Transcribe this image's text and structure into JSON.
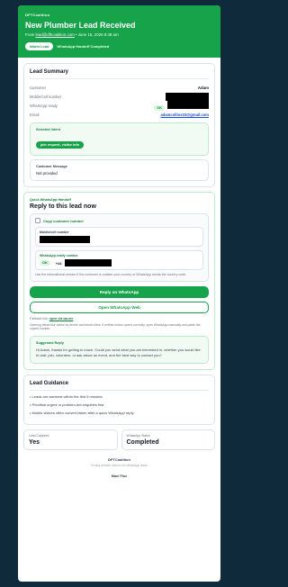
{
  "header": {
    "brand": "DFTCoalition",
    "title": "New Plumber Lead Received",
    "from_prefix": "From",
    "from_address": "lead@dftcoalition.com",
    "date_text": " • June 15, 2026 8:48 am",
    "badge_pill": "Warm Lead",
    "badge_text": "WhatsApp Handoff Completed"
  },
  "lead_summary": {
    "heading": "Lead Summary",
    "customer_label": "Customer",
    "customer_value": "Adam",
    "mobile_label": "Mobile/cell number",
    "whatsapp_label": "WhatsApp ready",
    "whatsapp_chip": "OK",
    "email_label": "Email",
    "email_value": "adamcollins33@gmail.com"
  },
  "selected_intent": {
    "label": "Selected Intent",
    "tag": "join request, visitor info"
  },
  "customer_message": {
    "label": "Customer Message",
    "value": "Not provided"
  },
  "handoff": {
    "kicker": "Quick WhatsApp Handoff",
    "heading": "Reply to this lead now",
    "copy_label": "Copy customer number",
    "mobile_field_label": "Mobile/cell number",
    "whatsapp_field_label": "WhatsApp-ready number",
    "country_code": "+44",
    "hint": "Use the international version if the customer is outside your country or WhatsApp needs the country code.",
    "reply_button": "Reply on WhatsApp",
    "open_button": "Open WhatsApp Web",
    "fallback_prefix": "Fallback link:",
    "fallback_link": "open via wa.me",
    "note": "Opening behaviour varies by device and email client. If neither button opens correctly, open WhatsApp manually and paste the copied number."
  },
  "suggested_reply": {
    "label": "Suggested Reply",
    "text": "Hi Adam, thanks for getting in touch. Could you send what you are interested in, whether you would like to visit, join, volunteer, or ask about an event, and the best way to contact you?"
  },
  "guidance": {
    "heading": "Lead Guidance",
    "items": [
      "Leads are warmest within the first 5 minutes.",
      "Prioritise urgent or problem-led enquiries first.",
      "Mobile visitors often convert faster after a quick WhatsApp reply."
    ]
  },
  "stats": {
    "captured_label": "Lead Captured",
    "captured_value": "Yes",
    "status_label": "WhatsApp Status",
    "status_value": "Completed"
  },
  "footer": {
    "brand": "DFTCoalition",
    "sub": "Turning website visitors into WhatsApp leads.",
    "powered": "Mani Flux"
  },
  "colors": {
    "accent": "#16a34a",
    "background": "#0f2a3a",
    "link": "#1d4ed8"
  }
}
